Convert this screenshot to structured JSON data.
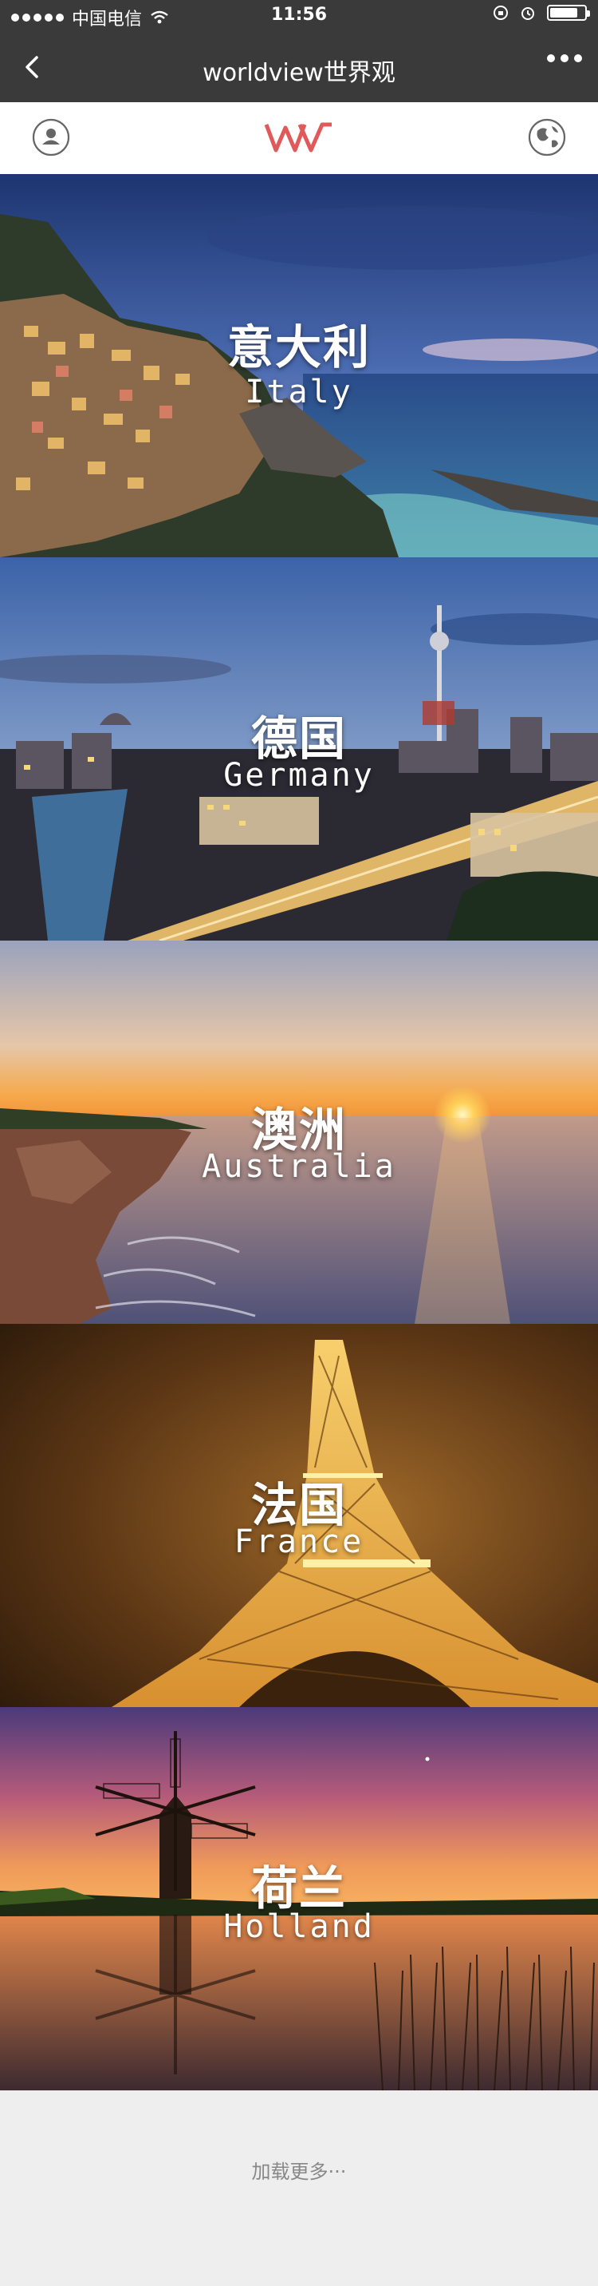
{
  "status_bar": {
    "carrier": "中国电信",
    "time": "11:56",
    "battery_level": 0.8
  },
  "nav": {
    "title": "worldview世界观"
  },
  "header": {
    "logo_text": "WV",
    "brand_color": "#e05a5a"
  },
  "destinations": [
    {
      "cn": "意大利",
      "en": "Italy"
    },
    {
      "cn": "德国",
      "en": "Germany"
    },
    {
      "cn": "澳洲",
      "en": "Australia"
    },
    {
      "cn": "法国",
      "en": "France"
    },
    {
      "cn": "荷兰",
      "en": "Holland"
    }
  ],
  "load_more": "加载更多···",
  "colors": {
    "nav_bg": "#3a3a3a",
    "page_bg": "#eeeeee",
    "text_muted": "#888888"
  }
}
